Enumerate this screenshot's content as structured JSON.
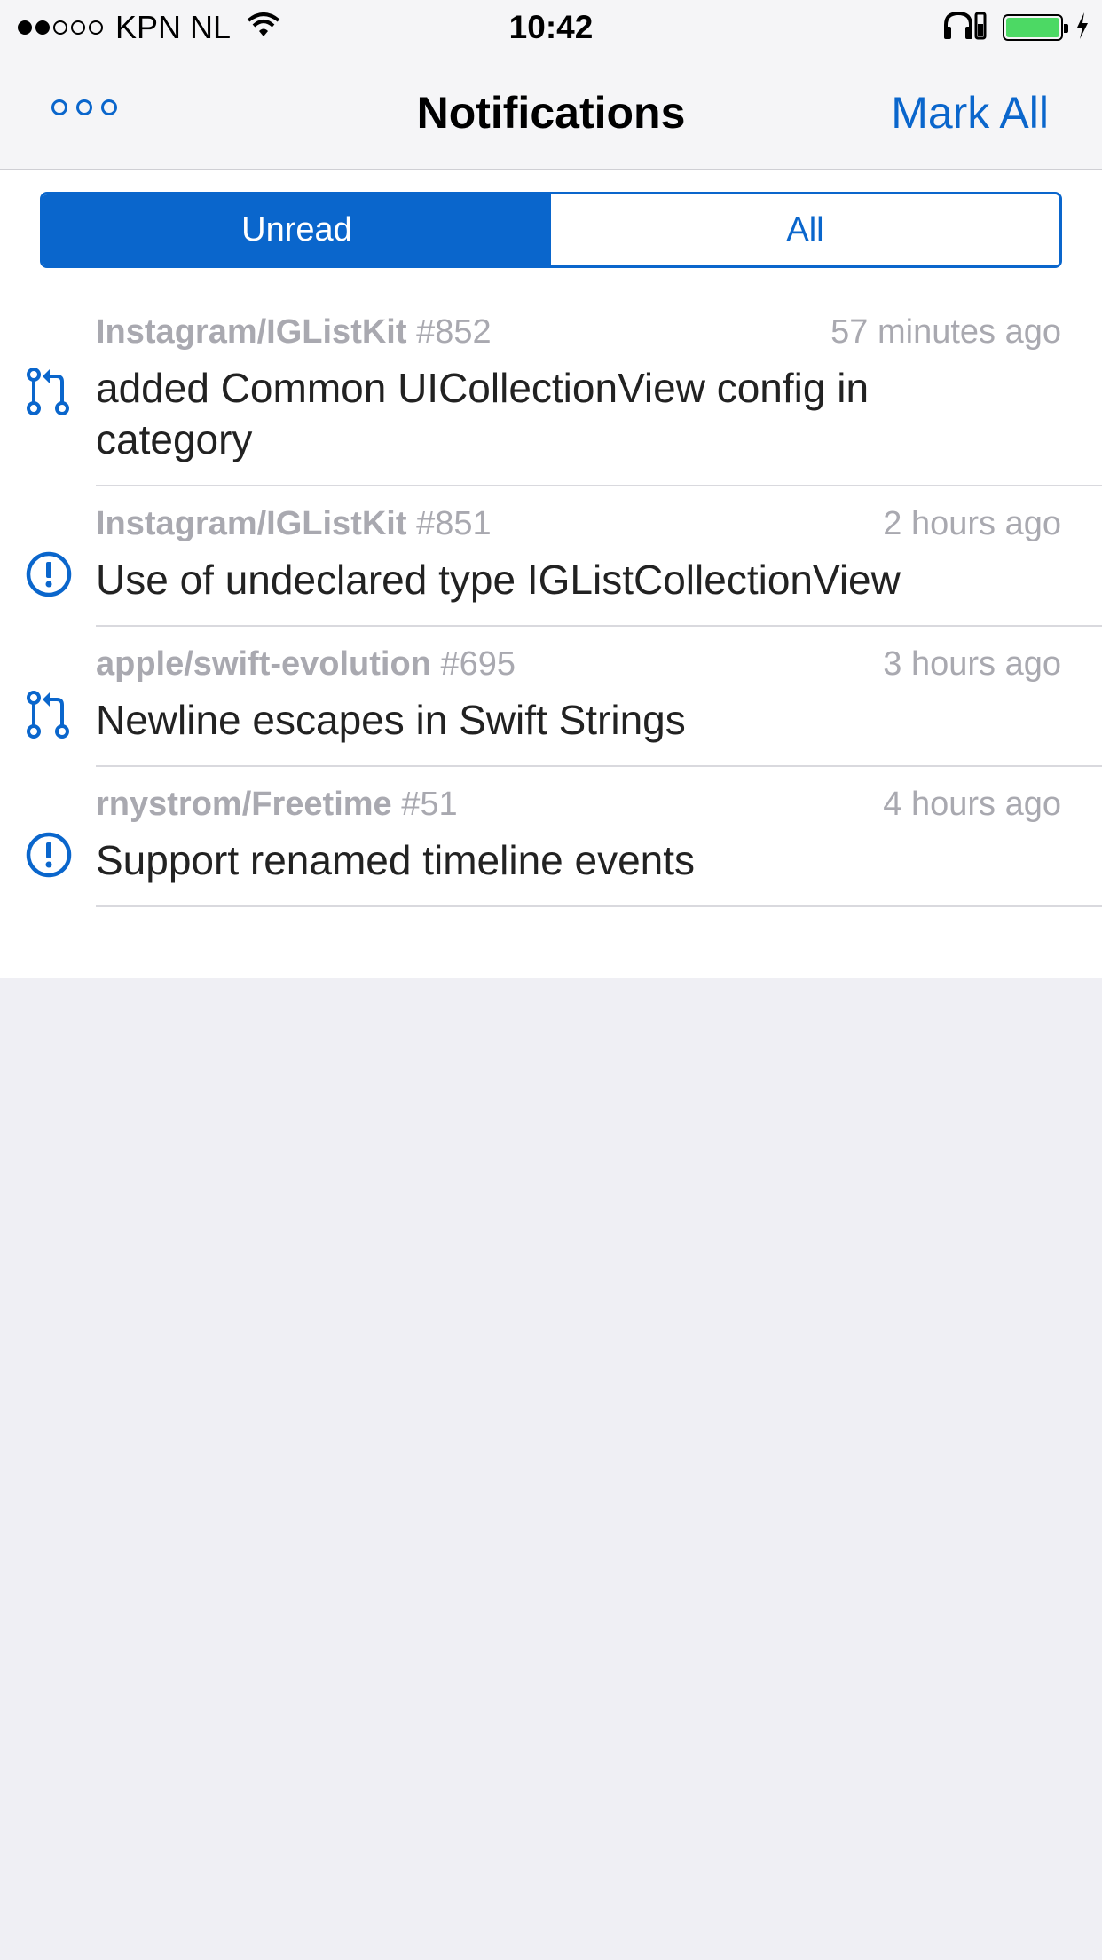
{
  "status": {
    "carrier": "KPN NL",
    "time": "10:42"
  },
  "nav": {
    "title": "Notifications",
    "mark_all": "Mark All"
  },
  "segments": {
    "unread": "Unread",
    "all": "All",
    "selected": "Unread"
  },
  "notifications": [
    {
      "type": "pull-request",
      "repo": "Instagram/IGListKit",
      "number": "#852",
      "time": "57 minutes ago",
      "title": "added  Common UICollectionView config in category"
    },
    {
      "type": "issue",
      "repo": "Instagram/IGListKit",
      "number": "#851",
      "time": "2 hours ago",
      "title": "Use of undeclared type IGListCollectionView"
    },
    {
      "type": "pull-request",
      "repo": "apple/swift-evolution",
      "number": "#695",
      "time": "3 hours ago",
      "title": "Newline escapes in Swift Strings"
    },
    {
      "type": "issue",
      "repo": "rnystrom/Freetime",
      "number": "#51",
      "time": "4 hours ago",
      "title": "Support renamed timeline events"
    }
  ],
  "colors": {
    "accent": "#0a66cc",
    "battery": "#4cd964",
    "meta_text": "#a9a9b0",
    "background": "#efeff4"
  },
  "icons": {
    "pull_request": "git-pull-request-icon",
    "issue": "issue-opened-icon"
  }
}
